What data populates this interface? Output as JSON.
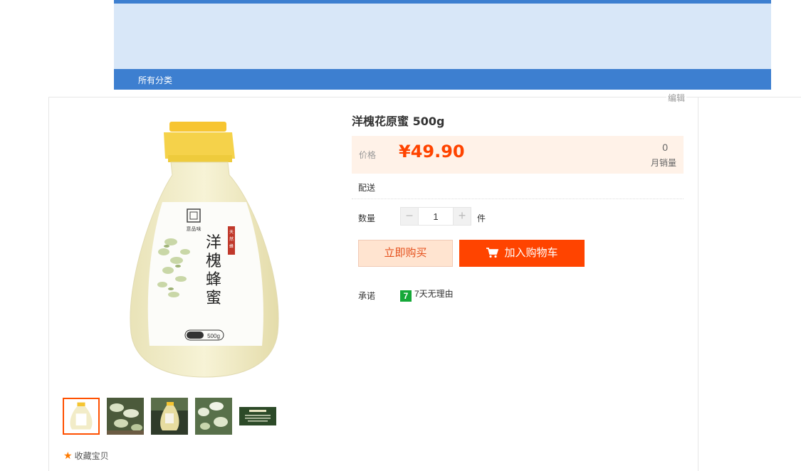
{
  "nav": {
    "all_categories": "所有分类"
  },
  "edit_label": "编辑",
  "product": {
    "title": "洋槐花原蜜 500g",
    "price_label": "价格",
    "price": "¥49.90",
    "monthly_sales": "0",
    "monthly_sales_label": "月销量",
    "shipping_label": "配送",
    "quantity_label": "数量",
    "quantity": "1",
    "unit": "件",
    "buy_now": "立即购买",
    "add_to_cart": "加入购物车",
    "promise_label": "承诺",
    "promise_icon_text": "7",
    "promise_text": "7天无理由",
    "favorite": "收藏宝贝",
    "bottle_label": "洋槐蜂蜜",
    "bottle_weight_text": "净含量 500g"
  },
  "colors": {
    "accent_blue": "#3d7fd0",
    "header_light_blue": "#d8e7f8",
    "price_orange": "#ff4400",
    "promise_green": "#15a838"
  },
  "icons": [
    "minus-icon",
    "plus-icon",
    "cart-icon",
    "star-icon",
    "seven-day-icon"
  ]
}
